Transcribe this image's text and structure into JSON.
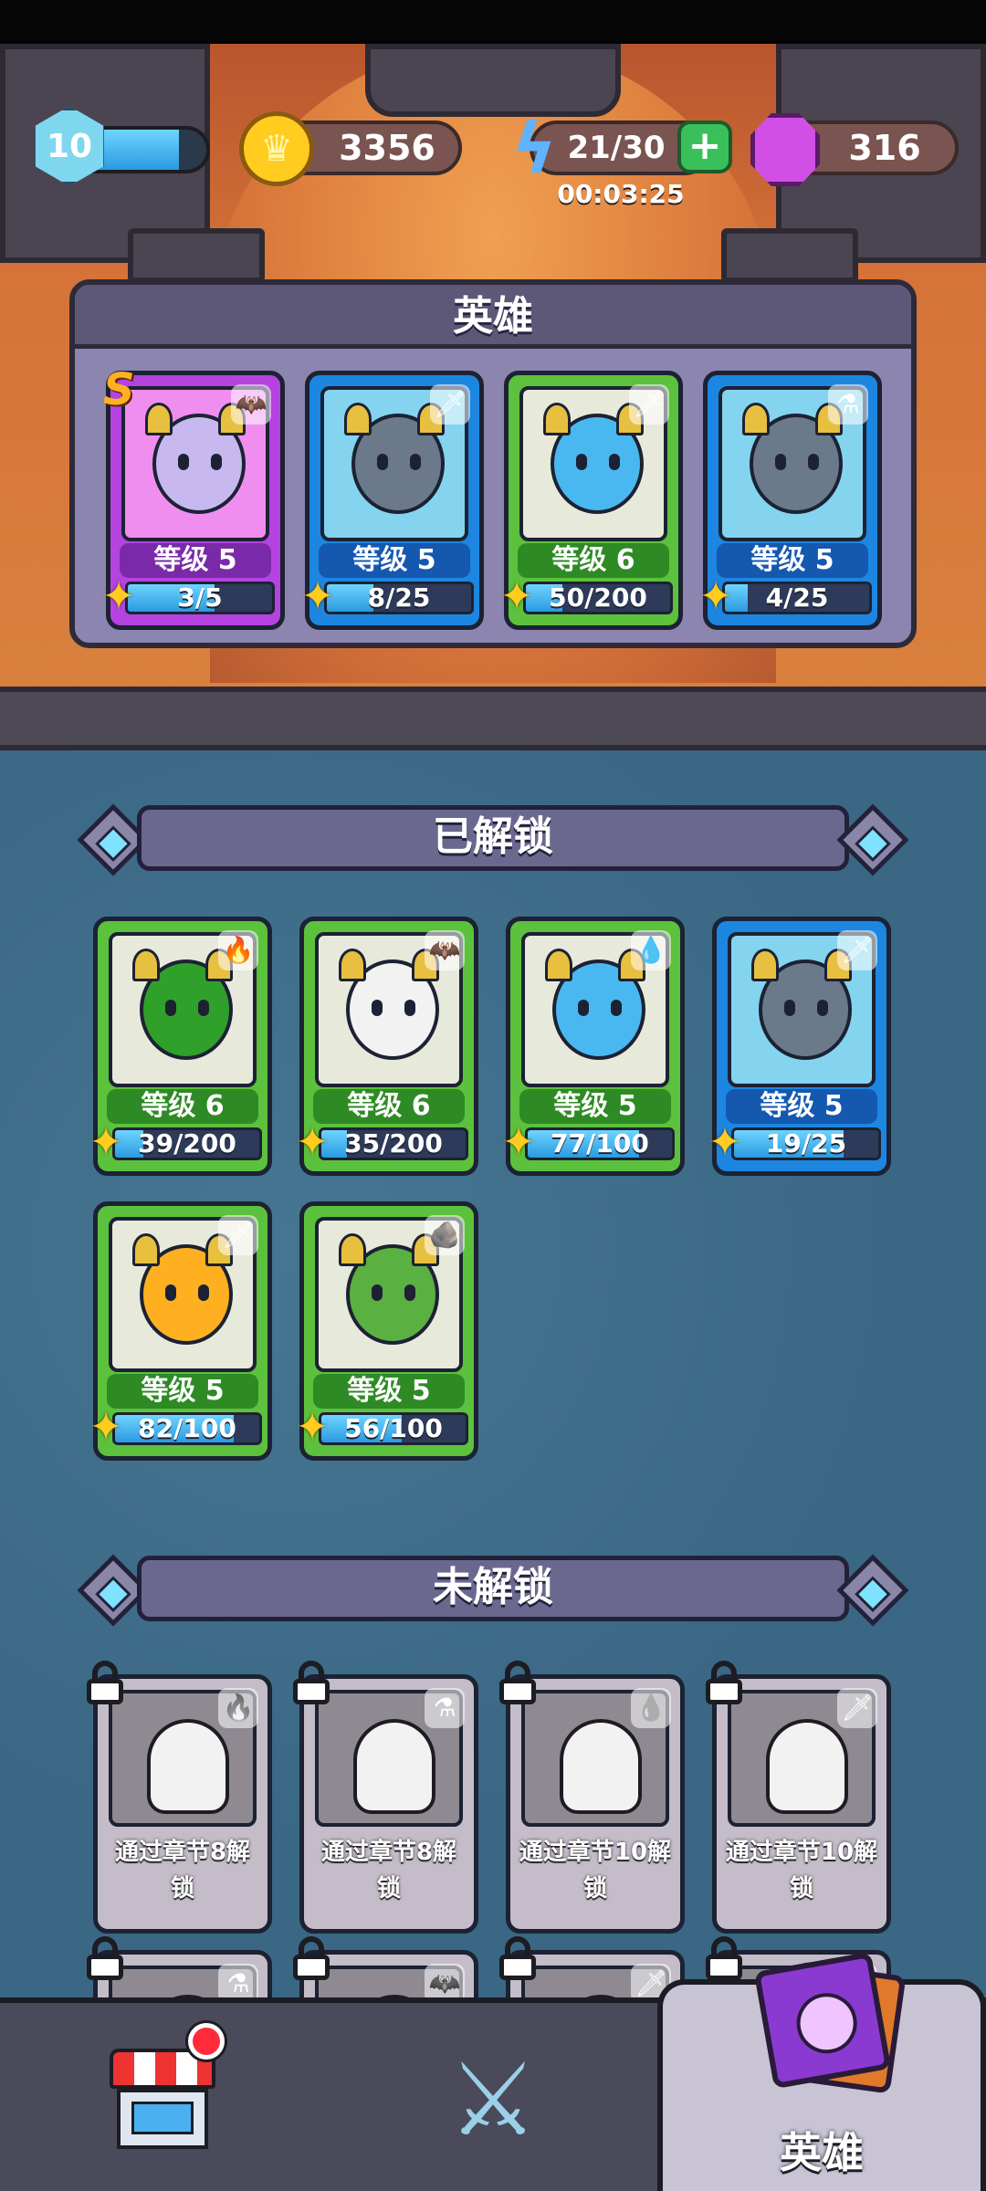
{
  "resources": {
    "player_level": "10",
    "player_xp_fraction": 0.75,
    "gold": "3356",
    "energy": "21/30",
    "energy_timer": "00:03:25",
    "gems": "316",
    "plus_symbol": "+"
  },
  "heroes_panel": {
    "title": "英雄",
    "cards": [
      {
        "rarity": "purple",
        "rank": "S",
        "element": "bat",
        "element_glyph": "🦇",
        "level": "等级 5",
        "progress": "3/5",
        "fraction": 0.6
      },
      {
        "rarity": "blue",
        "element": "sword",
        "element_glyph": "🗡",
        "level": "等级 5",
        "progress": "8/25",
        "fraction": 0.32
      },
      {
        "rarity": "green",
        "element": "sword",
        "element_glyph": "🗡",
        "level": "等级 6",
        "progress": "50/200",
        "fraction": 0.25
      },
      {
        "rarity": "blue",
        "element": "potion",
        "element_glyph": "⚗",
        "level": "等级 5",
        "progress": "4/25",
        "fraction": 0.16
      }
    ]
  },
  "unlocked": {
    "title": "已解锁",
    "cards": [
      {
        "rarity": "green",
        "element": "fire",
        "element_glyph": "🔥",
        "level": "等级 6",
        "progress": "39/200",
        "fraction": 0.195
      },
      {
        "rarity": "green",
        "element": "bat",
        "element_glyph": "🦇",
        "level": "等级 6",
        "progress": "35/200",
        "fraction": 0.175
      },
      {
        "rarity": "green",
        "element": "water",
        "element_glyph": "💧",
        "level": "等级 5",
        "progress": "77/100",
        "fraction": 0.77
      },
      {
        "rarity": "blue",
        "element": "sword",
        "element_glyph": "🗡",
        "level": "等级 5",
        "progress": "19/25",
        "fraction": 0.76
      },
      {
        "rarity": "green",
        "element": "sword",
        "element_glyph": "🗡",
        "level": "等级 5",
        "progress": "82/100",
        "fraction": 0.82
      },
      {
        "rarity": "green",
        "element": "rock",
        "element_glyph": "🪨",
        "level": "等级 5",
        "progress": "56/100",
        "fraction": 0.56
      }
    ]
  },
  "locked": {
    "title": "未解锁",
    "cards": [
      {
        "element": "fire",
        "element_glyph": "🔥",
        "requirement": "通过章节8解锁"
      },
      {
        "element": "potion",
        "element_glyph": "⚗",
        "requirement": "通过章节8解锁"
      },
      {
        "element": "water",
        "element_glyph": "💧",
        "requirement": "通过章节10解锁"
      },
      {
        "element": "sword",
        "element_glyph": "🗡",
        "requirement": "通过章节10解锁"
      },
      {
        "element": "potion",
        "element_glyph": "⚗",
        "requirement": ""
      },
      {
        "element": "bat",
        "element_glyph": "🦇",
        "requirement": ""
      },
      {
        "element": "sword",
        "element_glyph": "🗡",
        "requirement": ""
      },
      {
        "element": "water",
        "element_glyph": "💧",
        "requirement": ""
      }
    ]
  },
  "bottom_nav": {
    "shop_badge": true,
    "heroes_label": "英雄"
  }
}
